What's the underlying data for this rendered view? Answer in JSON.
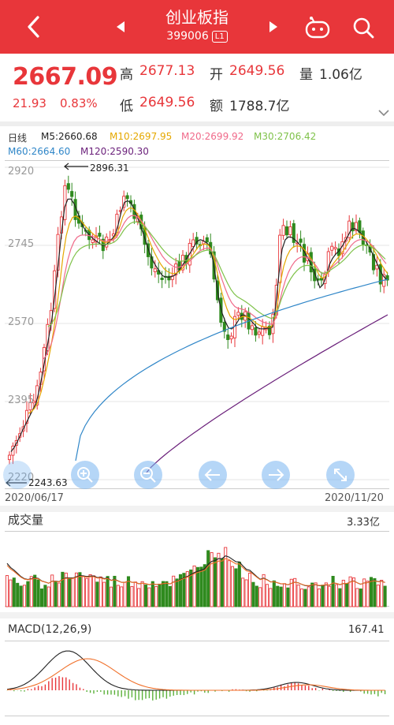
{
  "header": {
    "title": "创业板指",
    "code": "399006",
    "badge": "L1",
    "bg_color": "#e8363a"
  },
  "quote": {
    "price": "2667.09",
    "change": "21.93",
    "change_pct": "0.83%",
    "high_label": "高",
    "high": "2677.13",
    "open_label": "开",
    "open": "2649.56",
    "volume_label": "量",
    "volume": "1.06亿",
    "low_label": "低",
    "low": "2649.56",
    "amount_label": "额",
    "amount": "1788.7亿"
  },
  "ma": {
    "period": "日线",
    "ma5": "M5:2660.68",
    "ma10": "M10:2697.95",
    "ma20": "M20:2699.92",
    "ma30": "M30:2706.42",
    "ma60": "M60:2664.60",
    "ma120": "M120:2590.30",
    "colors": {
      "ma5": "#222222",
      "ma10": "#e5a800",
      "ma20": "#f06a8a",
      "ma30": "#7fc24a",
      "ma60": "#2f86c8",
      "ma120": "#6a1f7a"
    }
  },
  "chart": {
    "y_labels": [
      "2920",
      "2745",
      "2570",
      "2395",
      "2220"
    ],
    "high_marker": "2896.31",
    "low_marker": "2243.63",
    "start_date": "2020/06/17",
    "end_date": "2020/11/20",
    "up_color": "#e8363a",
    "down_color": "#2f8a1e"
  },
  "toolbar": {
    "buttons": [
      "zoom-in-icon",
      "zoom-out-icon",
      "arrow-left-icon",
      "arrow-right-icon",
      "fullscreen-icon"
    ]
  },
  "volume": {
    "title": "成交量",
    "max": "3.33亿"
  },
  "macd": {
    "title": "MACD(12,26,9)",
    "max": "167.41"
  }
}
